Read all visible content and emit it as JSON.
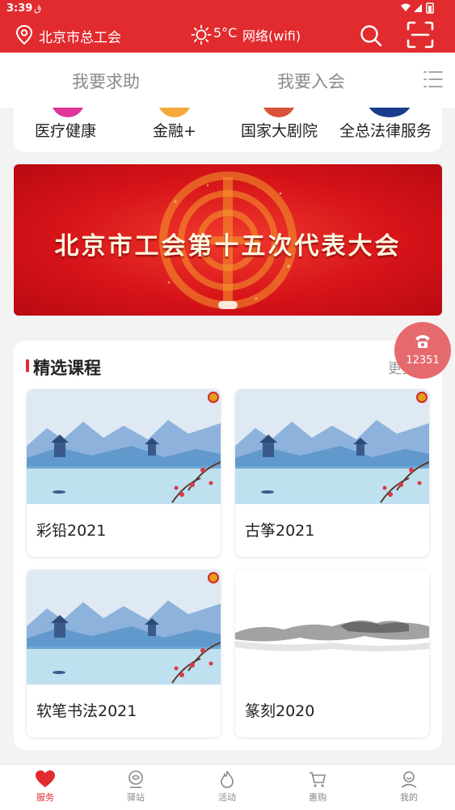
{
  "status_bar": {
    "time": "3:39",
    "carrier_glyph": "ق"
  },
  "top_bar": {
    "city": "北京市总工会",
    "temperature": "5°C",
    "network": "网络(wifi)",
    "icons": [
      "location-pin-icon",
      "sun-icon",
      "search-icon",
      "scan-icon"
    ]
  },
  "tabs": [
    {
      "label": "我要求助"
    },
    {
      "label": "我要入会"
    }
  ],
  "quick_services": [
    {
      "label": "医疗健康",
      "color": "#e0359a"
    },
    {
      "label": "金融+",
      "color": "#f4a93c"
    },
    {
      "label": "国家大剧院",
      "color": "#d9533a"
    },
    {
      "label": "全总法律服务",
      "color": "#183c8c"
    }
  ],
  "banner": {
    "title": "北京市工会第十五次代表大会"
  },
  "hotline": {
    "number": "12351"
  },
  "courses": {
    "title": "精选课程",
    "more": "更多",
    "items": [
      {
        "name": "彩铅2021",
        "thumb": "landscape"
      },
      {
        "name": "古筝2021",
        "thumb": "landscape"
      },
      {
        "name": "软笔书法2021",
        "thumb": "landscape"
      },
      {
        "name": "篆刻2020",
        "thumb": "ink"
      }
    ]
  },
  "bottom_nav": [
    {
      "label": "服务",
      "icon": "heart-icon",
      "active": true
    },
    {
      "label": "驿站",
      "icon": "station-icon",
      "active": false
    },
    {
      "label": "活动",
      "icon": "flame-icon",
      "active": false
    },
    {
      "label": "惠购",
      "icon": "cart-icon",
      "active": false
    },
    {
      "label": "我的",
      "icon": "user-icon",
      "active": false
    }
  ],
  "colors": {
    "brand_red": "#e12b2f",
    "hotline": "#e56a6e"
  }
}
